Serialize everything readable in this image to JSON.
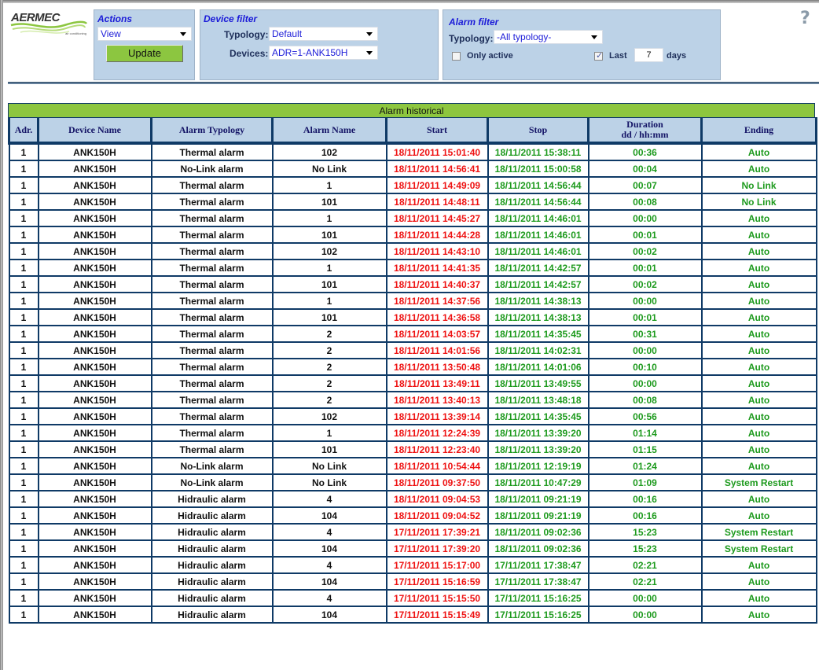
{
  "logo": {
    "brand": "AERMEC",
    "tagline": "air conditioning"
  },
  "actions": {
    "title": "Actions",
    "selected": "View",
    "update_label": "Update"
  },
  "device_filter": {
    "title": "Device filter",
    "typology_label": "Typology:",
    "typology_value": "Default",
    "devices_label": "Devices:",
    "devices_value": "ADR=1-ANK150H"
  },
  "alarm_filter": {
    "title": "Alarm filter",
    "typology_label": "Typology:",
    "typology_value": "-All typology-",
    "only_active_label": "Only active",
    "only_active_checked": false,
    "last_label": "Last",
    "last_checked": true,
    "days_value": "7",
    "days_label": "days"
  },
  "help": {
    "icon": "help-icon"
  },
  "table": {
    "caption": "Alarm historical",
    "headers": [
      "Adr.",
      "Device Name",
      "Alarm Typology",
      "Alarm Name",
      "Start",
      "Stop",
      "Duration",
      "Ending"
    ],
    "duration_subheader": "dd / hh:mm",
    "colors": {
      "start": "#ee1111",
      "stop": "#1d9a1d",
      "caption_bg": "#8dc63f",
      "header_bg": "#bcd2e7",
      "border": "#0f3a66"
    },
    "rows": [
      [
        "1",
        "ANK150H",
        "Thermal alarm",
        "102",
        "18/11/2011 15:01:40",
        "18/11/2011 15:38:11",
        "00:36",
        "Auto"
      ],
      [
        "1",
        "ANK150H",
        "No-Link alarm",
        "No Link",
        "18/11/2011 14:56:41",
        "18/11/2011 15:00:58",
        "00:04",
        "Auto"
      ],
      [
        "1",
        "ANK150H",
        "Thermal alarm",
        "1",
        "18/11/2011 14:49:09",
        "18/11/2011 14:56:44",
        "00:07",
        "No Link"
      ],
      [
        "1",
        "ANK150H",
        "Thermal alarm",
        "101",
        "18/11/2011 14:48:11",
        "18/11/2011 14:56:44",
        "00:08",
        "No Link"
      ],
      [
        "1",
        "ANK150H",
        "Thermal alarm",
        "1",
        "18/11/2011 14:45:27",
        "18/11/2011 14:46:01",
        "00:00",
        "Auto"
      ],
      [
        "1",
        "ANK150H",
        "Thermal alarm",
        "101",
        "18/11/2011 14:44:28",
        "18/11/2011 14:46:01",
        "00:01",
        "Auto"
      ],
      [
        "1",
        "ANK150H",
        "Thermal alarm",
        "102",
        "18/11/2011 14:43:10",
        "18/11/2011 14:46:01",
        "00:02",
        "Auto"
      ],
      [
        "1",
        "ANK150H",
        "Thermal alarm",
        "1",
        "18/11/2011 14:41:35",
        "18/11/2011 14:42:57",
        "00:01",
        "Auto"
      ],
      [
        "1",
        "ANK150H",
        "Thermal alarm",
        "101",
        "18/11/2011 14:40:37",
        "18/11/2011 14:42:57",
        "00:02",
        "Auto"
      ],
      [
        "1",
        "ANK150H",
        "Thermal alarm",
        "1",
        "18/11/2011 14:37:56",
        "18/11/2011 14:38:13",
        "00:00",
        "Auto"
      ],
      [
        "1",
        "ANK150H",
        "Thermal alarm",
        "101",
        "18/11/2011 14:36:58",
        "18/11/2011 14:38:13",
        "00:01",
        "Auto"
      ],
      [
        "1",
        "ANK150H",
        "Thermal alarm",
        "2",
        "18/11/2011 14:03:57",
        "18/11/2011 14:35:45",
        "00:31",
        "Auto"
      ],
      [
        "1",
        "ANK150H",
        "Thermal alarm",
        "2",
        "18/11/2011 14:01:56",
        "18/11/2011 14:02:31",
        "00:00",
        "Auto"
      ],
      [
        "1",
        "ANK150H",
        "Thermal alarm",
        "2",
        "18/11/2011 13:50:48",
        "18/11/2011 14:01:06",
        "00:10",
        "Auto"
      ],
      [
        "1",
        "ANK150H",
        "Thermal alarm",
        "2",
        "18/11/2011 13:49:11",
        "18/11/2011 13:49:55",
        "00:00",
        "Auto"
      ],
      [
        "1",
        "ANK150H",
        "Thermal alarm",
        "2",
        "18/11/2011 13:40:13",
        "18/11/2011 13:48:18",
        "00:08",
        "Auto"
      ],
      [
        "1",
        "ANK150H",
        "Thermal alarm",
        "102",
        "18/11/2011 13:39:14",
        "18/11/2011 14:35:45",
        "00:56",
        "Auto"
      ],
      [
        "1",
        "ANK150H",
        "Thermal alarm",
        "1",
        "18/11/2011 12:24:39",
        "18/11/2011 13:39:20",
        "01:14",
        "Auto"
      ],
      [
        "1",
        "ANK150H",
        "Thermal alarm",
        "101",
        "18/11/2011 12:23:40",
        "18/11/2011 13:39:20",
        "01:15",
        "Auto"
      ],
      [
        "1",
        "ANK150H",
        "No-Link alarm",
        "No Link",
        "18/11/2011 10:54:44",
        "18/11/2011 12:19:19",
        "01:24",
        "Auto"
      ],
      [
        "1",
        "ANK150H",
        "No-Link alarm",
        "No Link",
        "18/11/2011 09:37:50",
        "18/11/2011 10:47:29",
        "01:09",
        "System Restart"
      ],
      [
        "1",
        "ANK150H",
        "Hidraulic alarm",
        "4",
        "18/11/2011 09:04:53",
        "18/11/2011 09:21:19",
        "00:16",
        "Auto"
      ],
      [
        "1",
        "ANK150H",
        "Hidraulic alarm",
        "104",
        "18/11/2011 09:04:52",
        "18/11/2011 09:21:19",
        "00:16",
        "Auto"
      ],
      [
        "1",
        "ANK150H",
        "Hidraulic alarm",
        "4",
        "17/11/2011 17:39:21",
        "18/11/2011 09:02:36",
        "15:23",
        "System Restart"
      ],
      [
        "1",
        "ANK150H",
        "Hidraulic alarm",
        "104",
        "17/11/2011 17:39:20",
        "18/11/2011 09:02:36",
        "15:23",
        "System Restart"
      ],
      [
        "1",
        "ANK150H",
        "Hidraulic alarm",
        "4",
        "17/11/2011 15:17:00",
        "17/11/2011 17:38:47",
        "02:21",
        "Auto"
      ],
      [
        "1",
        "ANK150H",
        "Hidraulic alarm",
        "104",
        "17/11/2011 15:16:59",
        "17/11/2011 17:38:47",
        "02:21",
        "Auto"
      ],
      [
        "1",
        "ANK150H",
        "Hidraulic alarm",
        "4",
        "17/11/2011 15:15:50",
        "17/11/2011 15:16:25",
        "00:00",
        "Auto"
      ],
      [
        "1",
        "ANK150H",
        "Hidraulic alarm",
        "104",
        "17/11/2011 15:15:49",
        "17/11/2011 15:16:25",
        "00:00",
        "Auto"
      ]
    ]
  }
}
